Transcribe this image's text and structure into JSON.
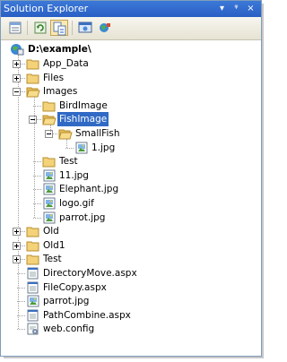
{
  "window": {
    "title": "Solution Explorer"
  },
  "titlebar_buttons": [
    {
      "name": "dropdown-arrow-icon",
      "glyph": "▾"
    },
    {
      "name": "pin-icon",
      "glyph": "ᵠ"
    },
    {
      "name": "close-icon",
      "glyph": "×"
    }
  ],
  "toolbar": [
    {
      "name": "properties-button",
      "icon": "properties-icon"
    },
    {
      "name": "refresh-button",
      "icon": "refresh-icon"
    },
    {
      "name": "nest-related-files-button",
      "icon": "nest-files-icon",
      "pressed": true
    },
    {
      "name": "view-in-browser-button",
      "icon": "browser-icon"
    },
    {
      "name": "copy-website-button",
      "icon": "copy-website-icon"
    }
  ],
  "tree": {
    "root": {
      "label": "D:\\example\\",
      "icon": "website-icon"
    },
    "items": [
      {
        "label": "App_Data",
        "icon": "folder",
        "level": 1,
        "expander": "plus"
      },
      {
        "label": "Files",
        "icon": "folder",
        "level": 1,
        "expander": "plus"
      },
      {
        "label": "Images",
        "icon": "folder-open",
        "level": 1,
        "expander": "minus"
      },
      {
        "label": "BirdImage",
        "icon": "folder",
        "level": 2
      },
      {
        "label": "FishImage",
        "icon": "folder-open",
        "level": 2,
        "expander": "minus",
        "selected": true
      },
      {
        "label": "SmallFish",
        "icon": "folder-open",
        "level": 3,
        "expander": "minus"
      },
      {
        "label": "1.jpg",
        "icon": "image",
        "level": 4
      },
      {
        "label": "Test",
        "icon": "folder",
        "level": 2
      },
      {
        "label": "11.jpg",
        "icon": "image",
        "level": 2
      },
      {
        "label": "Elephant.jpg",
        "icon": "image",
        "level": 2
      },
      {
        "label": "logo.gif",
        "icon": "image",
        "level": 2
      },
      {
        "label": "parrot.jpg",
        "icon": "image",
        "level": 2
      },
      {
        "label": "Old",
        "icon": "folder",
        "level": 1,
        "expander": "plus"
      },
      {
        "label": "Old1",
        "icon": "folder",
        "level": 1,
        "expander": "plus"
      },
      {
        "label": "Test",
        "icon": "folder",
        "level": 1,
        "expander": "plus"
      },
      {
        "label": "DirectoryMove.aspx",
        "icon": "aspx",
        "level": 1
      },
      {
        "label": "FileCopy.aspx",
        "icon": "aspx",
        "level": 1
      },
      {
        "label": "parrot.jpg",
        "icon": "image",
        "level": 1
      },
      {
        "label": "PathCombine.aspx",
        "icon": "aspx",
        "level": 1
      },
      {
        "label": "web.config",
        "icon": "config",
        "level": 1
      }
    ]
  },
  "colors": {
    "selection": "#316ac5",
    "folder": "#f3d27a",
    "title_bar": "#2a5fc4"
  }
}
